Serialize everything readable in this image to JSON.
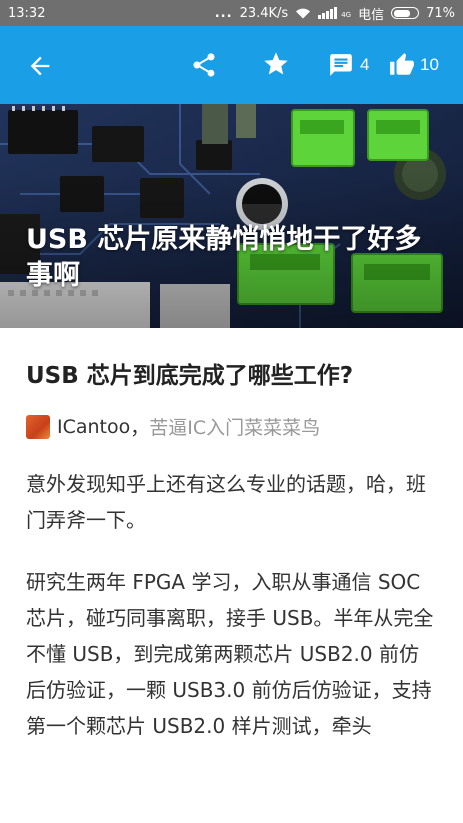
{
  "status_bar": {
    "time": "13:32",
    "dots": "...",
    "speed": "23.4K/s",
    "network_label": "4G",
    "carrier": "电信",
    "battery": "71%",
    "battery_level": 0.71
  },
  "app_bar": {
    "comment_count": "4",
    "like_count": "10"
  },
  "hero": {
    "title": "USB 芯片原来静悄悄地干了好多事啊"
  },
  "article": {
    "question_title": "USB 芯片到底完成了哪些工作?",
    "author_name": "ICantoo",
    "author_sep": "，",
    "author_bio": "苦逼IC入门菜菜菜鸟",
    "paragraphs": [
      "意外发现知乎上还有这么专业的话题，哈，班门弄斧一下。",
      "研究生两年 FPGA 学习，入职从事通信 SOC 芯片，碰巧同事离职，接手 USB。半年从完全不懂 USB，到完成第两颗芯片 USB2.0 前仿后仿验证，一颗 USB3.0 前仿后仿验证，支持第一个颗芯片 USB2.0 样片测试，牵头"
    ]
  },
  "colors": {
    "app_bar": "#1a9fe6",
    "status_bar": "#6f6f6f"
  }
}
